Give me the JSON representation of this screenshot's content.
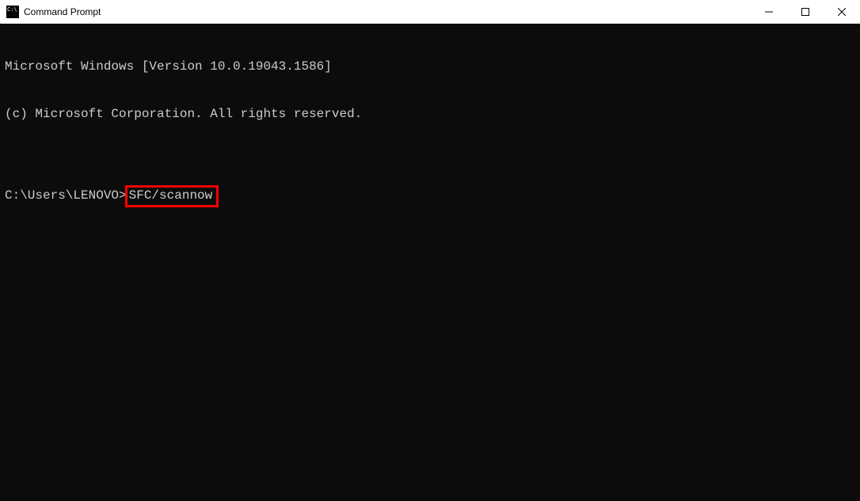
{
  "window": {
    "title": "Command Prompt"
  },
  "terminal": {
    "line1": "Microsoft Windows [Version 10.0.19043.1586]",
    "line2": "(c) Microsoft Corporation. All rights reserved.",
    "blank": "",
    "prompt": "C:\\Users\\LENOVO>",
    "command": "SFC/scannow"
  }
}
